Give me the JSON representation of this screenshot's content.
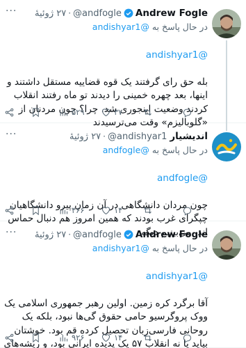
{
  "tweets": [
    {
      "name": "Andrew Fogle",
      "handle": "@andfogle",
      "date": "۲۷ ژوئیهٔ",
      "replying_prefix": "در حال پاسخ به",
      "replying_to": "@andishyar1",
      "lead": "@andishyar1",
      "text": "بله حق رای گرفتند یک قوه قضاییه مستقل داشتند و اینها، بعد چهره خمینی را دیدند تو ماه رفتند انقلاب کردند وضعیت اینجوری شد. چرا؟ چون مردنان از «گلوبالیزم» وقت می‌ترسیدند",
      "metrics": {
        "views": "۵۲۹",
        "likes": "۳۷",
        "retweets": "",
        "replies": ""
      },
      "avatar": "andrew-fogle-avatar"
    },
    {
      "name": "اندیشیار",
      "handle": "@andishyar1",
      "date": "۲۷ ژوئیهٔ",
      "replying_prefix": "در حال پاسخ به",
      "replying_to": "@andfogle",
      "lead": "@andfogle",
      "text": "چون مردان دانشگاهی در آن زمان پیرو دانشگاهیان چپگرای غرب بودند که همین امروز هم دنبال حماس اند. می‌بینیم دیگه",
      "metrics": {
        "views": "۴۶۶",
        "likes": "۱۴",
        "retweets": "",
        "replies": ""
      },
      "avatar": "andishyar-logo"
    },
    {
      "name": "Andrew Fogle",
      "handle": "@andfogle",
      "date": "۲۷ ژوئیهٔ",
      "replying_prefix": "در حال پاسخ به",
      "replying_to": "@andishyar1",
      "lead": "@andishyar1",
      "text": "آقا برگرد کره زمین. اولین رهبر جمهوری اسلامی یک ووک پروگرسیو حامی حقوق گی‌ها نبود، بلکه یک روحانی فارسی‌زبان تحصیل کرده قم بود. خوشتان بیاید یا نه انقلاب ۵۷ یک پدیده ایرانی بود، و ریشه‌های آن به همین ملیگرایی ارزش‌محور بر می‌گردد.",
      "metrics": {
        "views": "۹۲۶",
        "likes": "۱۴",
        "retweets": "",
        "replies": ""
      },
      "avatar": "andrew-fogle-avatar"
    }
  ],
  "colors": {
    "accent": "#1d9bf0",
    "muted": "#536471",
    "text": "#0f1419",
    "verified": "#1d9bf0",
    "andishyar_bg": "#1e90c8"
  }
}
